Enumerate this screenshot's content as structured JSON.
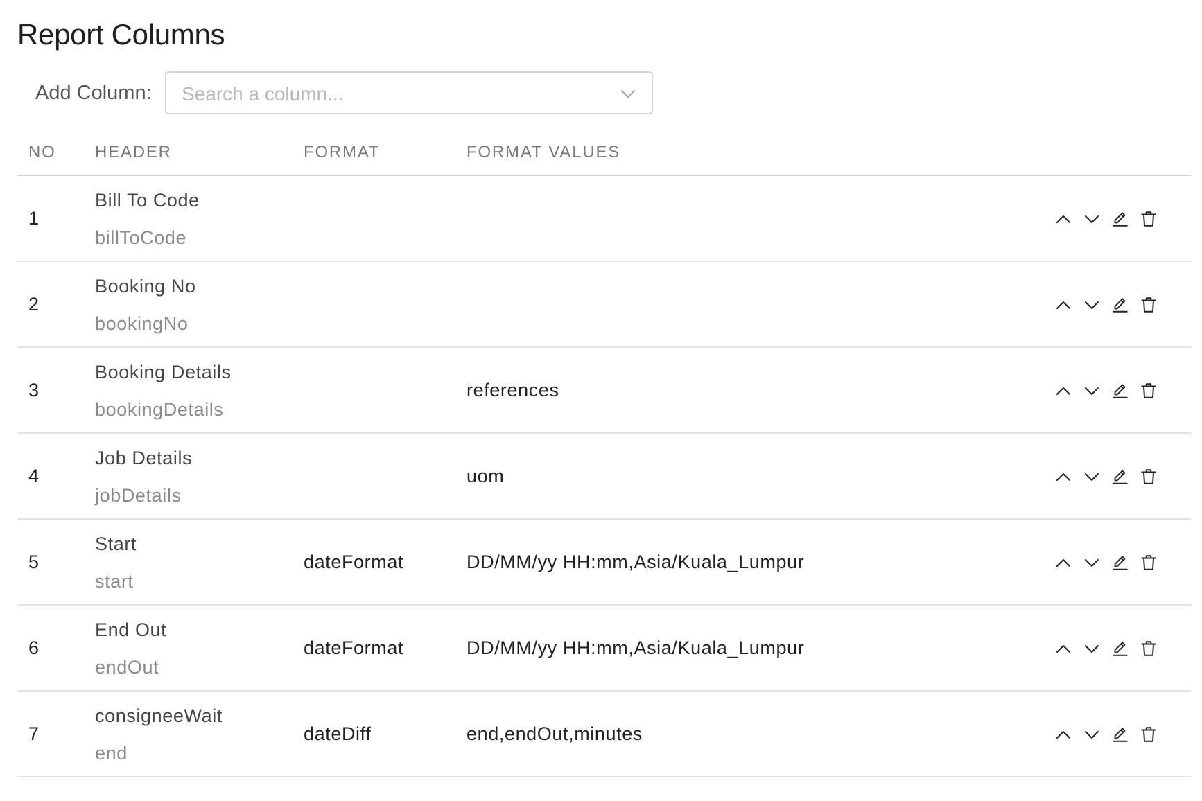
{
  "title": "Report Columns",
  "add_column": {
    "label": "Add Column:",
    "placeholder": "Search a column...",
    "icon": "chevron-down-icon"
  },
  "table": {
    "headers": {
      "no": "NO",
      "header": "HEADER",
      "format": "FORMAT",
      "format_values": "FORMAT VALUES"
    },
    "rows": [
      {
        "no": "1",
        "header": "Bill To Code",
        "key": "billToCode",
        "format": "",
        "values": ""
      },
      {
        "no": "2",
        "header": "Booking No",
        "key": "bookingNo",
        "format": "",
        "values": ""
      },
      {
        "no": "3",
        "header": "Booking Details",
        "key": "bookingDetails",
        "format": "",
        "values": "references"
      },
      {
        "no": "4",
        "header": "Job Details",
        "key": "jobDetails",
        "format": "",
        "values": "uom"
      },
      {
        "no": "5",
        "header": "Start",
        "key": "start",
        "format": "dateFormat",
        "values": "DD/MM/yy HH:mm,Asia/Kuala_Lumpur"
      },
      {
        "no": "6",
        "header": "End Out",
        "key": "endOut",
        "format": "dateFormat",
        "values": "DD/MM/yy HH:mm,Asia/Kuala_Lumpur"
      },
      {
        "no": "7",
        "header": "consigneeWait",
        "key": "end",
        "format": "dateDiff",
        "values": "end,endOut,minutes"
      }
    ],
    "row_actions": [
      "chevron-up-icon",
      "chevron-down-icon",
      "pencil-icon",
      "trash-icon"
    ]
  },
  "colors": {
    "text": "#222222",
    "muted": "#8a8a8a",
    "header_text": "#7a7a7a",
    "border": "#d3d3d3",
    "row_border": "#e3e3e3",
    "input_border": "#d4d4d4",
    "placeholder": "#b9b9b9"
  }
}
